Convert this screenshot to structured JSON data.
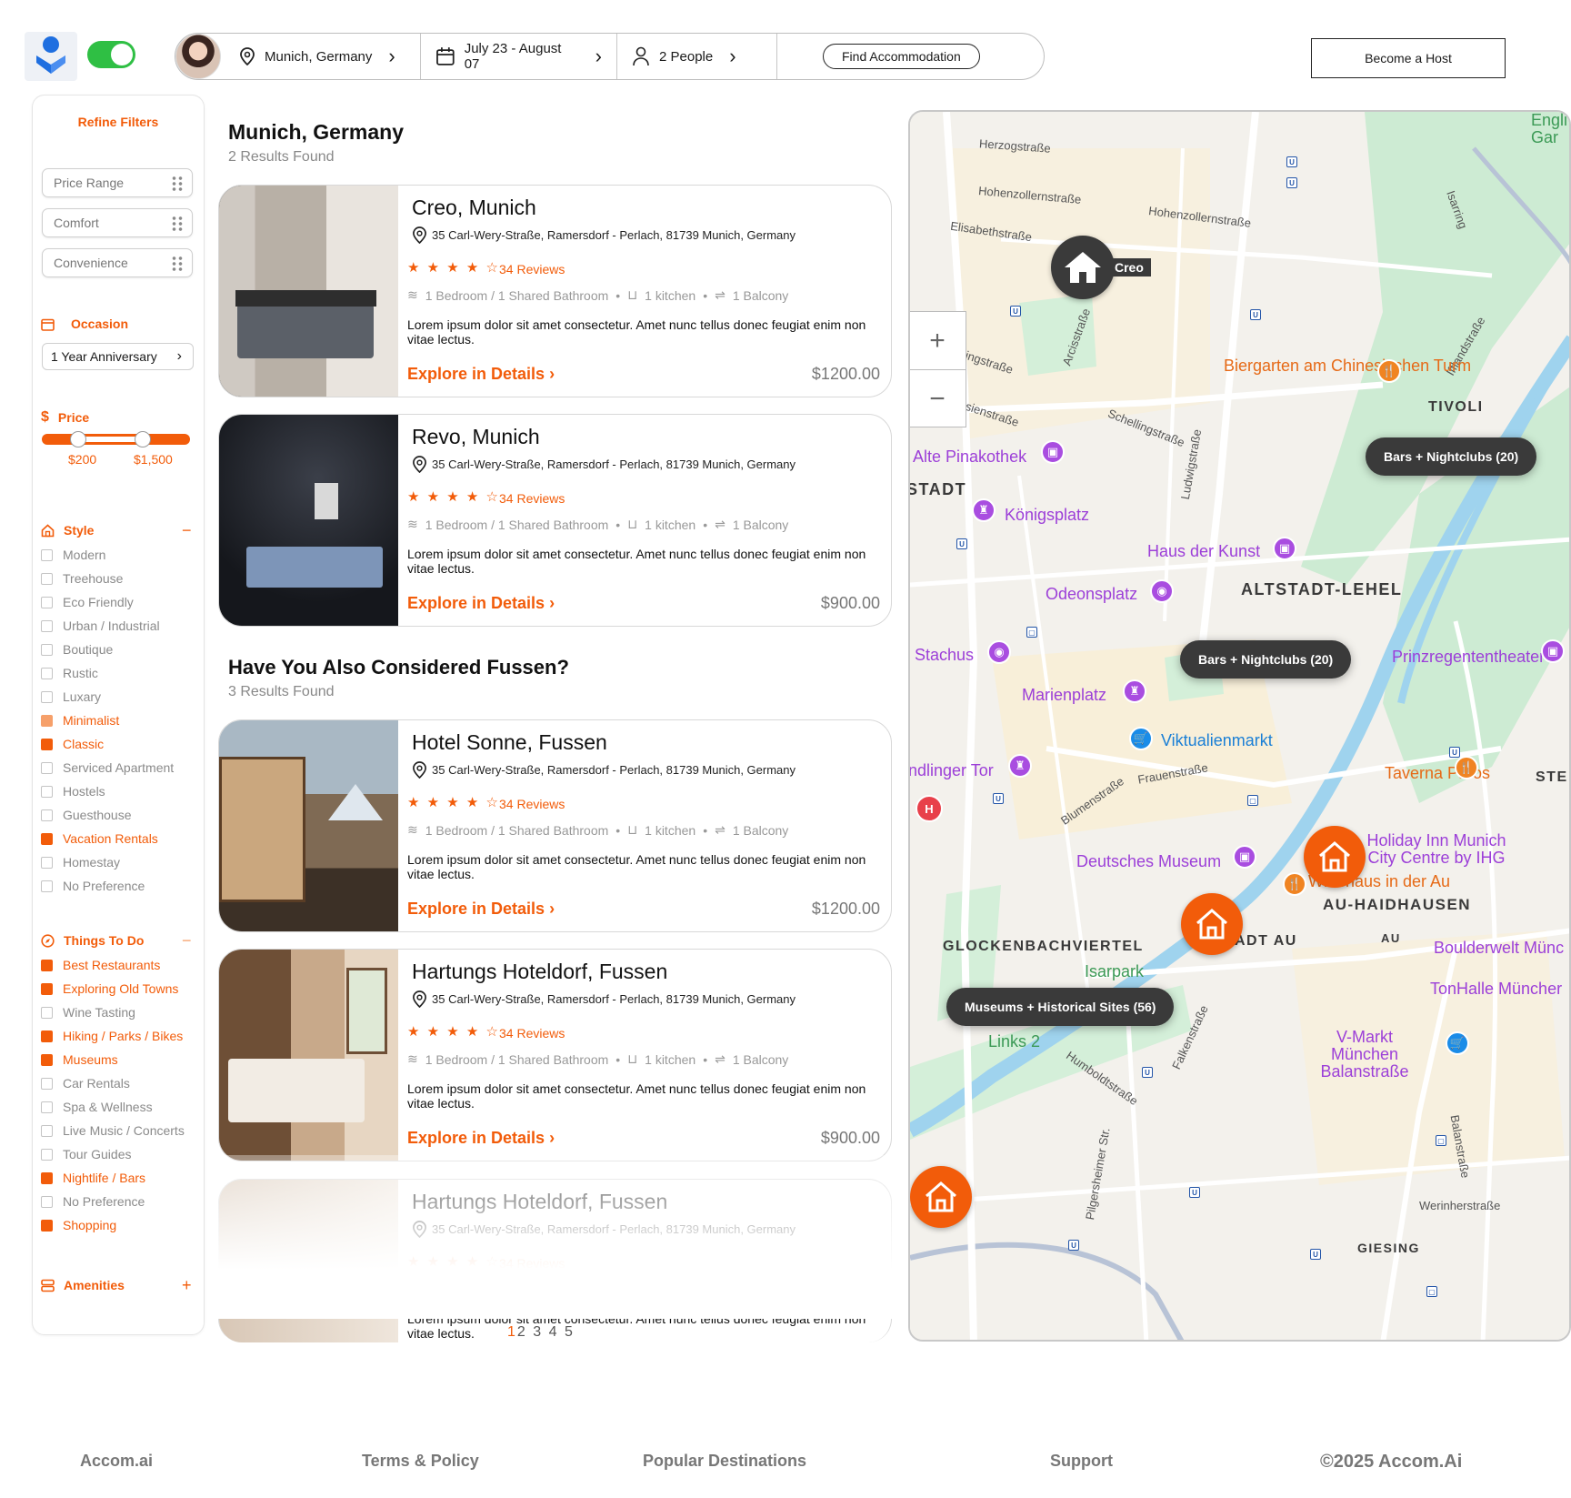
{
  "header": {
    "location": "Munich, Germany",
    "dates": "July 23 - August 07",
    "people": "2 People",
    "find_label": "Find Accommodation",
    "host_label": "Become a Host"
  },
  "sidebar": {
    "title": "Refine Filters",
    "pills": [
      "Price Range",
      "Comfort",
      "Convenience"
    ],
    "occasion": {
      "label": "Occasion",
      "value": "1 Year Anniversary"
    },
    "price": {
      "label": "Price",
      "min": "$200",
      "max": "$1,500"
    },
    "style": {
      "label": "Style",
      "items": [
        {
          "label": "Modern",
          "state": "off"
        },
        {
          "label": "Treehouse",
          "state": "off"
        },
        {
          "label": "Eco Friendly",
          "state": "off"
        },
        {
          "label": "Urban / Industrial",
          "state": "off"
        },
        {
          "label": "Boutique",
          "state": "off"
        },
        {
          "label": "Rustic",
          "state": "off"
        },
        {
          "label": "Luxary",
          "state": "off"
        },
        {
          "label": "Minimalist",
          "state": "partial"
        },
        {
          "label": "Classic",
          "state": "on"
        },
        {
          "label": "Serviced Apartment",
          "state": "off"
        },
        {
          "label": "Hostels",
          "state": "off"
        },
        {
          "label": "Guesthouse",
          "state": "off"
        },
        {
          "label": "Vacation Rentals",
          "state": "on"
        },
        {
          "label": "Homestay",
          "state": "off"
        },
        {
          "label": "No Preference",
          "state": "off"
        }
      ]
    },
    "things": {
      "label": "Things To Do",
      "items": [
        {
          "label": "Best Restaurants",
          "state": "on"
        },
        {
          "label": "Exploring Old Towns",
          "state": "on"
        },
        {
          "label": "Wine Tasting",
          "state": "off"
        },
        {
          "label": "Hiking  / Parks / Bikes",
          "state": "on"
        },
        {
          "label": "Museums",
          "state": "on"
        },
        {
          "label": "Car Rentals",
          "state": "off"
        },
        {
          "label": "Spa &  Wellness",
          "state": "off"
        },
        {
          "label": "Live Music / Concerts",
          "state": "off"
        },
        {
          "label": "Tour Guides",
          "state": "off"
        },
        {
          "label": "Nightlife / Bars",
          "state": "on"
        },
        {
          "label": "No Preference",
          "state": "off"
        },
        {
          "label": "Shopping",
          "state": "on"
        }
      ]
    },
    "amenities_label": "Amenities"
  },
  "results": {
    "title": "Munich, Germany",
    "count": "2 Results Found",
    "alt_title": "Have You Also Considered Fussen?",
    "alt_count": "3 Results Found",
    "common": {
      "address": "35 Carl-Wery-Straße, Ramersdorf - Perlach, 81739 Munich, Germany",
      "stars": "★ ★ ★ ★ ☆",
      "reviews": "34 Reviews",
      "bedroom": "1 Bedroom / 1 Shared Bathroom",
      "kitchen": "1 kitchen",
      "balcony": "1 Balcony",
      "desc": "Lorem ipsum dolor sit amet consectetur. Amet nunc tellus donec feugiat enim non vitae lectus.",
      "explore": "Explore in Details"
    },
    "cards": [
      {
        "name": "Creo, Munich",
        "price": "$1200.00"
      },
      {
        "name": "Revo, Munich",
        "price": "$900.00"
      },
      {
        "name": "Hotel Sonne, Fussen",
        "price": "$1200.00"
      },
      {
        "name": "Hartungs Hoteldorf, Fussen",
        "price": "$900.00"
      },
      {
        "name": "Hartungs Hoteldorf, Fussen",
        "price": ""
      }
    ],
    "pages": {
      "current": "1",
      "others": "2 3 4 5"
    }
  },
  "map": {
    "creo": "Creo",
    "pills": [
      "Bars + Nightclubs (20)",
      "Bars + Nightclubs (20)",
      "Museums + Historical Sites (56)"
    ],
    "places": {
      "biergarten": "Biergarten am Chinesischen Turm",
      "pinakothek": "Alte Pinakothek",
      "koenigsplatz": "Königsplatz",
      "hausderkunst": "Haus der Kunst",
      "odeonsplatz": "Odeonsplatz",
      "stachus": "Stachus",
      "marienplatz": "Marienplatz",
      "viktualien": "Viktualienmarkt",
      "sendlinger": "ndlinger Tor",
      "taverna": "Taverna Paros",
      "prinzregent": "Prinzregententheater",
      "deutsches": "Deutsches Museum",
      "holiday": "Holiday Inn Munich City Centre by IHG",
      "wirtshaus": "Wirtshaus in der Au",
      "boulder": "Boulderwelt Münc",
      "tonhalle": "TonHalle Müncher",
      "vmarkt": "V-Markt München Balanstraße",
      "isarpark": "Isarpark",
      "links2": "Links 2",
      "english": "Engli Gar"
    },
    "districts": [
      "TIVOLI",
      "STADT",
      "ALTSTADT-LEHEL",
      "AU-HAIDHAUSEN",
      "GLOCKENBACHVIERTEL",
      "GIESING",
      "AU",
      "ADT AU",
      "STE"
    ],
    "streets": [
      "Herzogstraße",
      "Hohenzollernstraße",
      "Hohenzollernstraße",
      "Elisabethstraße",
      "ingstraße",
      "sienstraße",
      "Schellingstraße",
      "Ludwigstraße",
      "Frauenstraße",
      "Blumenstraße",
      "Humboldtstraße",
      "Falkenstraße",
      "Pilgersheimer Str.",
      "Werinherstraße",
      "Balanstraße",
      "Arcisstraße",
      "Isarring",
      "Ifflandstraße"
    ]
  },
  "footer": {
    "brand": "Accom.ai",
    "terms": "Terms & Policy",
    "popular": "Popular Destinations",
    "support": "Support",
    "copyright": "©2025 Accom.Ai"
  },
  "colors": {
    "accent": "#f25c0a",
    "toggle": "#2fbf44",
    "map_pill": "#3a3a3a"
  }
}
